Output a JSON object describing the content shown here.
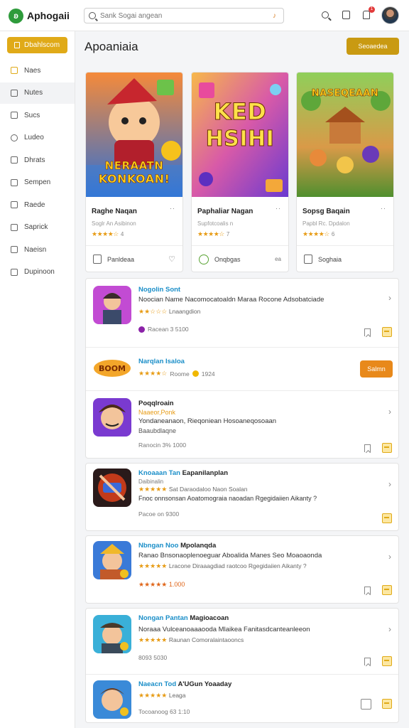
{
  "app": {
    "name": "Aphogaii"
  },
  "search": {
    "placeholder": "Sank Sogai angean"
  },
  "notifications": {
    "count": "1"
  },
  "sidebar": {
    "primary_button": "Dbahlscom",
    "items": [
      {
        "label": "Naes",
        "icon": "home-icon"
      },
      {
        "label": "Nutes",
        "icon": "book-icon"
      },
      {
        "label": "Sucs",
        "icon": "layers-icon"
      },
      {
        "label": "Ludeo",
        "icon": "clock-icon"
      },
      {
        "label": "Dhrats",
        "icon": "document-icon"
      },
      {
        "label": "Sempen",
        "icon": "calendar-icon"
      },
      {
        "label": "Raede",
        "icon": "user-icon"
      },
      {
        "label": "Saprick",
        "icon": "send-icon"
      },
      {
        "label": "Naeisn",
        "icon": "box-icon"
      },
      {
        "label": "Dupinoon",
        "icon": "list-icon"
      }
    ]
  },
  "main": {
    "title": "Apoaniaia",
    "header_button": "Seoaedea",
    "featured": [
      {
        "name": "Raghe Naqan",
        "dots": "··",
        "subtitle": "Soglr An Asibinon",
        "stars": "★★★★☆",
        "rating": "4",
        "footer_label": "Panldeaa",
        "art_text_1": "NERAATN",
        "art_text_2": "KONKOAN!",
        "colors": {
          "bg1": "#f0682a",
          "bg2": "#2d6fd6"
        }
      },
      {
        "name": "Paphaliar Nagan",
        "dots": "··",
        "subtitle": "Supfotcoalis n",
        "stars": "★★★★☆",
        "rating": "7",
        "footer_label": "Onqbgas",
        "footer_extra": "ea",
        "art_text_1": "KED",
        "art_text_2": "HSIHI",
        "colors": {
          "bg1": "#f5a623",
          "bg2": "#7b3fd0"
        }
      },
      {
        "name": "Sopsg Baqain",
        "dots": "··",
        "subtitle": "Papbl Rc. Dpdalon",
        "stars": "★★★★☆",
        "rating": "6",
        "footer_label": "Soghaia",
        "art_text_1": "NASEQEAAN",
        "colors": {
          "bg1": "#6fb84a",
          "bg2": "#f0a032"
        }
      }
    ],
    "list_cards": [
      {
        "rows": [
          {
            "title": "Nogolin Sont",
            "desc": "Noocian Name Nacomocatoaldn Maraa Rocone Adsobatciade",
            "stars": "★★☆☆☆",
            "stars_text": "Lnaangdion",
            "meta": "Racean 3 5100",
            "meta_icon": "purple-dot"
          },
          {
            "title": "Narqlan Isaloa",
            "stars": "★★★★☆",
            "stars_text": "Roome",
            "meta": "1924",
            "button": "Salmn"
          },
          {
            "title": "Poqqlroain",
            "subtitle": "Naaeor,Ponk",
            "desc": "Yondaneanaon, Rieqoniean Hosoaneqosoaan",
            "extra": "Baaubdlaqne",
            "meta": "Ranocin 3% 1000"
          }
        ]
      },
      {
        "rows": [
          {
            "title": "Knoaaan Tan",
            "title_dark": "Eapanilanplan",
            "subtitle": "Daibinalin",
            "stars": "★★★★★",
            "stars_text": "Sat Daraodaloo Naon Soalan",
            "desc": "Fnoc onnsonsan Aoatomograia naoadan Rgegidaiien Aikanty ?",
            "meta": "Pacoe on 9300"
          },
          {
            "title": "Nbngan Noo",
            "title_dark": "Mpolanqda",
            "desc": "Ranao Bnsonaoplenoeguar Aboalida Manes Seo Moaoaonda",
            "stars": "★★★★★",
            "stars_text": "Lracone Diraaagdiad raotcoo Rgegidaiien Aikanty ?",
            "meta": "★★★★★ 1.000"
          },
          {
            "title": "Nongan Pantan",
            "title_dark": "Magioacoan",
            "desc": "Noraaa Vulceanoaaaooda Mlaikea Fanitasdcanteanleeon",
            "stars": "★★★★★",
            "stars_text": "Raunan Comoralaintaooncs",
            "meta": "8093 5030"
          },
          {
            "title": "Naeacn Tod",
            "title_dark": "A'UGun Yoaaday",
            "stars": "★★★★★",
            "stars_text": "Leaga",
            "meta": "Tocoanoog 63 1:10"
          }
        ]
      }
    ]
  }
}
